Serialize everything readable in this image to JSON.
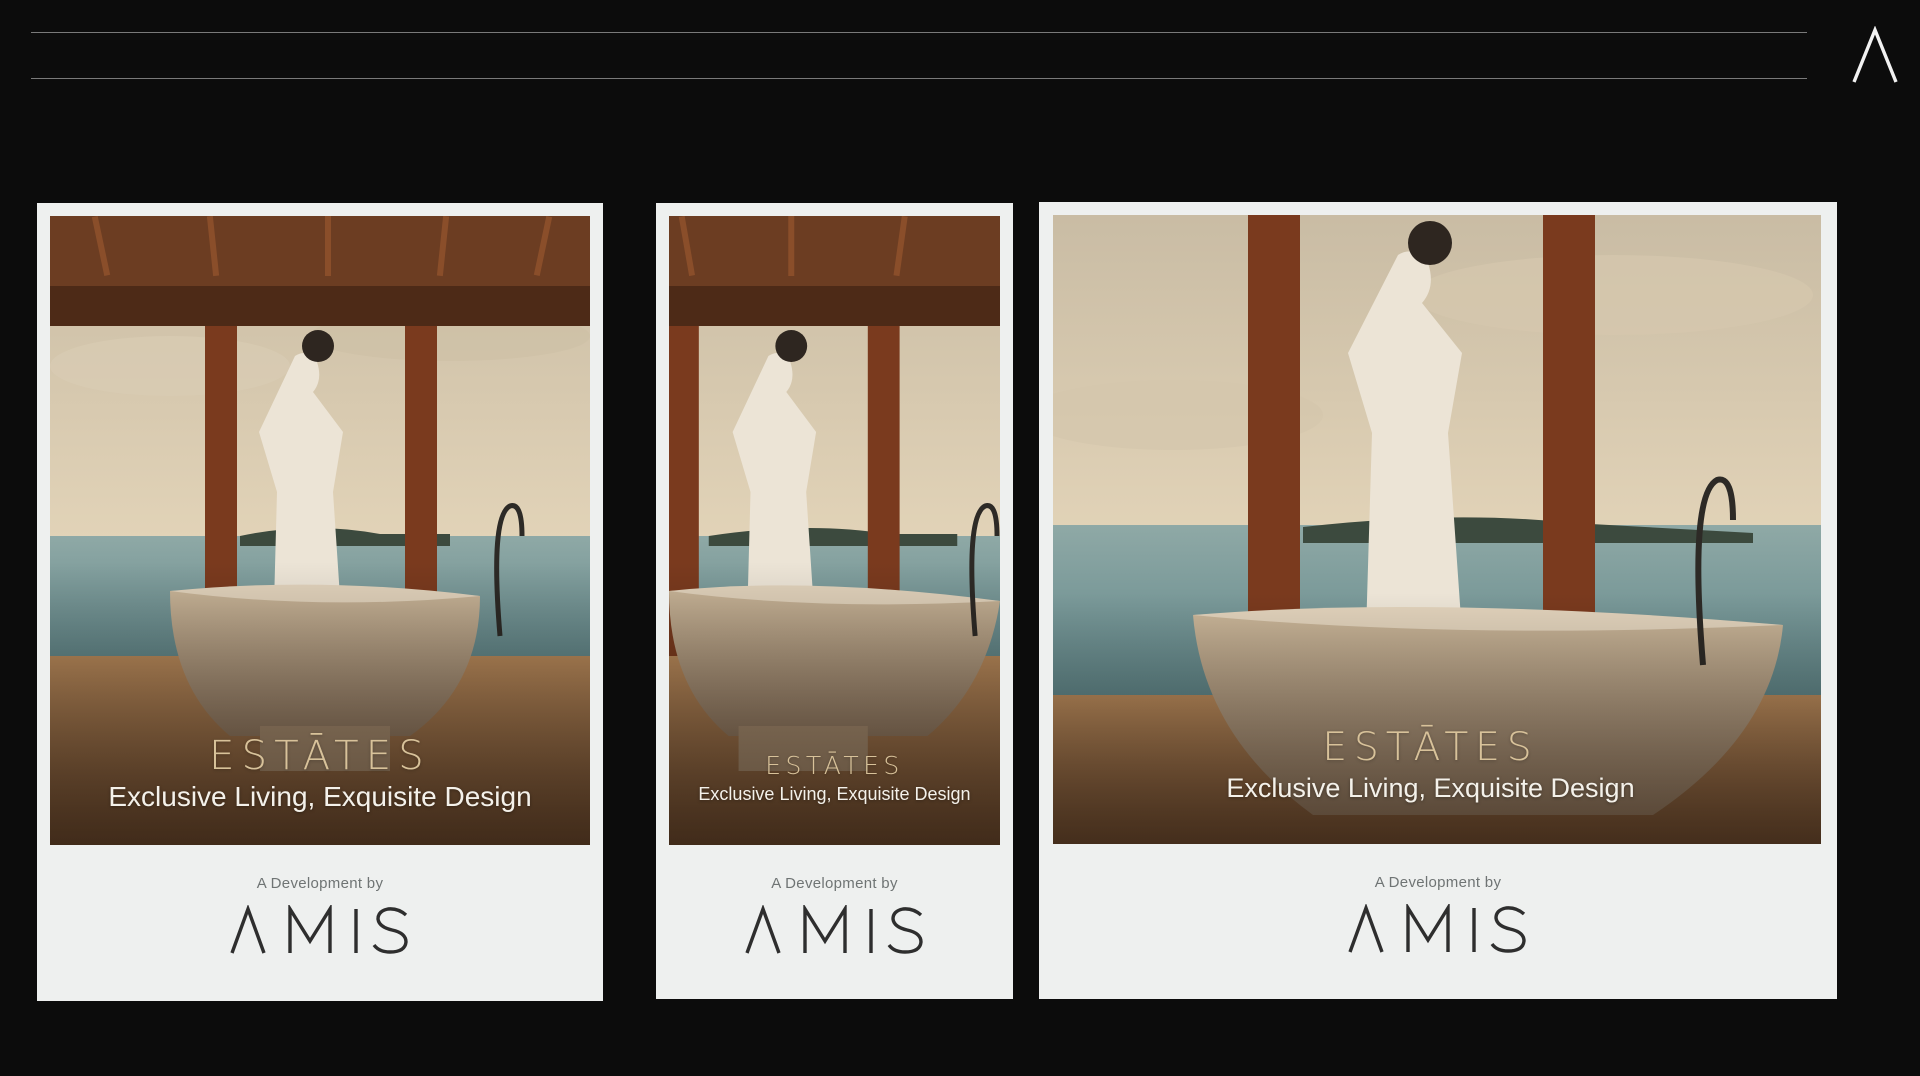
{
  "brand": {
    "mark_icon": "lambda-a-logo"
  },
  "cards": [
    {
      "variant": "portrait-wide",
      "title": "ESTĀTES",
      "tagline": "Exclusive Living, Exquisite Design",
      "credit": "A Development by",
      "developer": "AMIS"
    },
    {
      "variant": "portrait-narrow",
      "title": "ESTĀTES",
      "tagline": "Exclusive Living, Exquisite Design",
      "credit": "A Development by",
      "developer": "AMIS"
    },
    {
      "variant": "square",
      "title": "ESTĀTES",
      "tagline": "Exclusive Living, Exquisite Design",
      "credit": "A Development by",
      "developer": "AMIS"
    }
  ],
  "colors": {
    "background": "#0c0c0c",
    "card": "#eef0ef",
    "estates_gold": "#d8c29a",
    "logo_dark": "#2e2e2e"
  }
}
